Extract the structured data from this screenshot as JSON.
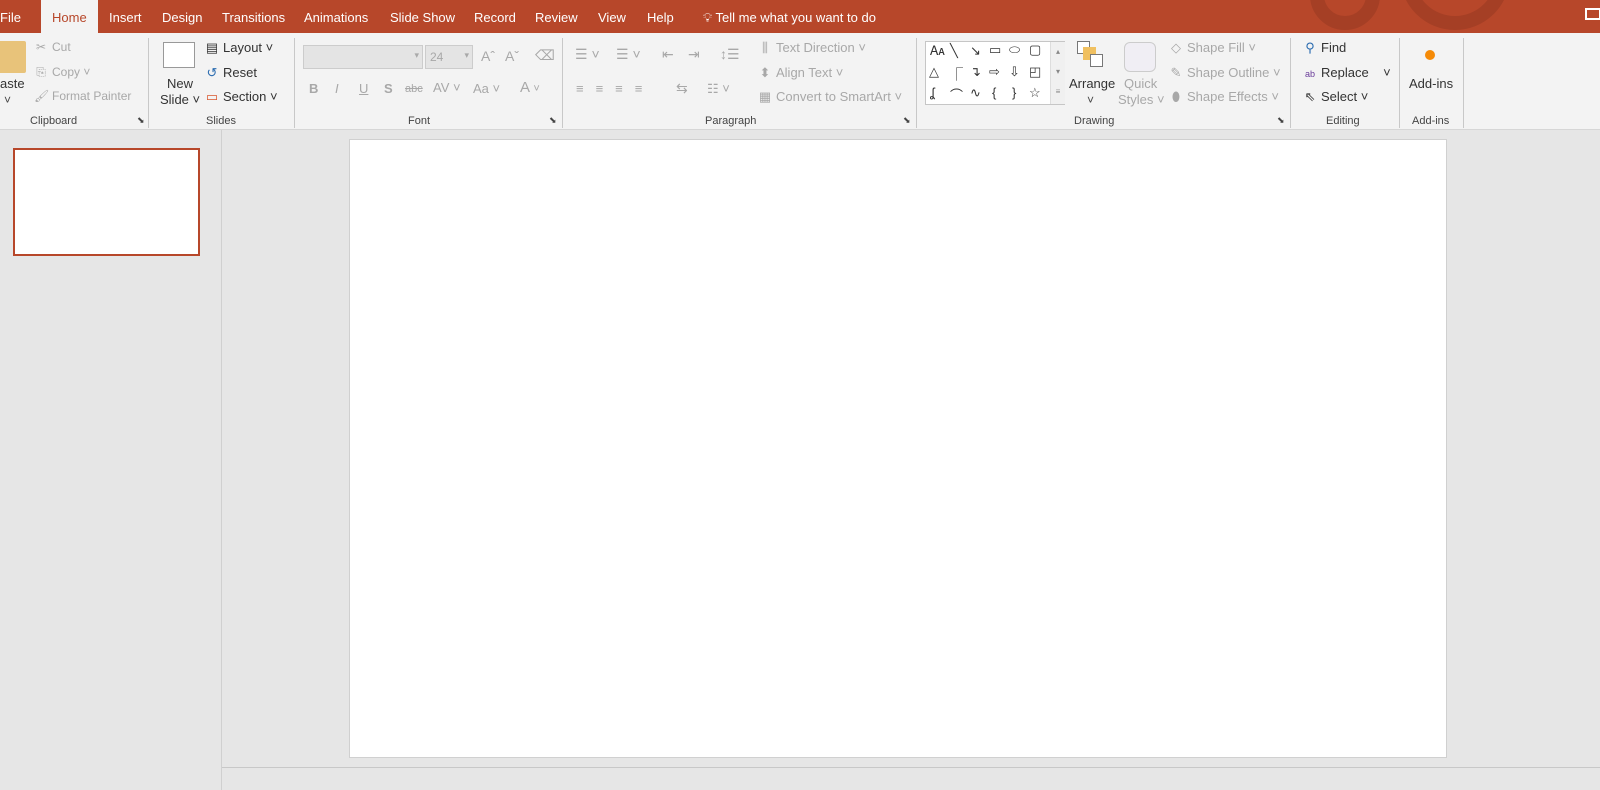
{
  "tabs": [
    "File",
    "Home",
    "Insert",
    "Design",
    "Transitions",
    "Animations",
    "Slide Show",
    "Record",
    "Review",
    "View",
    "Help"
  ],
  "tell_me": "Tell me what you want to do",
  "clipboard": {
    "paste": "aste",
    "cut": "Cut",
    "copy": "Copy",
    "format_painter": "Format Painter",
    "label": "Clipboard"
  },
  "slides": {
    "new_slide_1": "New",
    "new_slide_2": "Slide",
    "layout": "Layout",
    "reset": "Reset",
    "section": "Section",
    "label": "Slides"
  },
  "font": {
    "font_name": "",
    "font_size": "24",
    "bold": "B",
    "italic": "I",
    "underline": "U",
    "shadow": "S",
    "strike": "abc",
    "spacing": "AV",
    "case": "Aa",
    "color": "A",
    "label": "Font"
  },
  "paragraph": {
    "text_direction": "Text Direction",
    "align_text": "Align Text",
    "smartart": "Convert to SmartArt",
    "label": "Paragraph"
  },
  "drawing": {
    "arrange": "Arrange",
    "quick_1": "Quick",
    "quick_2": "Styles",
    "shape_fill": "Shape Fill",
    "shape_outline": "Shape Outline",
    "shape_effects": "Shape Effects",
    "label": "Drawing"
  },
  "editing": {
    "find": "Find",
    "replace": "Replace",
    "select": "Select",
    "label": "Editing"
  },
  "addins": {
    "button": "Add-ins",
    "label": "Add-ins"
  },
  "colors": {
    "accent": "#b7472a",
    "ribbon": "#f3f3f3",
    "workspace": "#e6e6e6"
  }
}
